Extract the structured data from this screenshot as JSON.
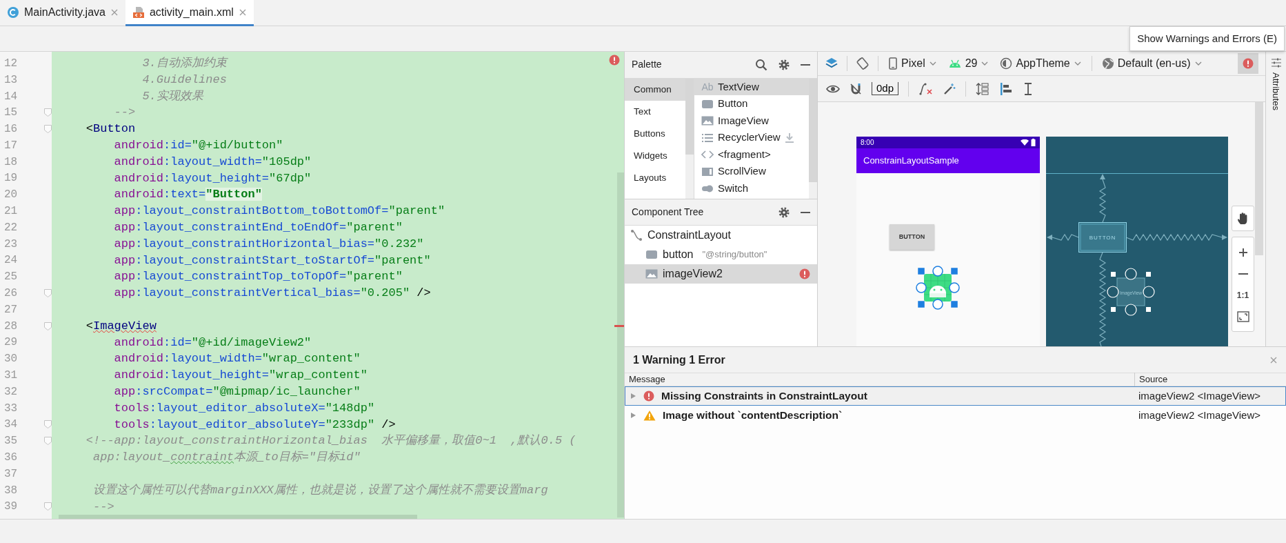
{
  "editor_tabs": [
    {
      "label": "MainActivity.java",
      "kind": "java",
      "selected": false
    },
    {
      "label": "activity_main.xml",
      "kind": "xml",
      "selected": true
    }
  ],
  "code_lines": [
    {
      "number": "12",
      "tokens": [
        {
          "kind": "comment",
          "text": "            3.自动添加约束"
        }
      ]
    },
    {
      "number": "13",
      "tokens": [
        {
          "kind": "comment",
          "text": "            4.Guidelines"
        }
      ]
    },
    {
      "number": "14",
      "tokens": [
        {
          "kind": "comment",
          "text": "            5.实现效果"
        }
      ]
    },
    {
      "number": "15",
      "fold": true,
      "tokens": [
        {
          "kind": "comment",
          "text": "        -->"
        }
      ]
    },
    {
      "number": "16",
      "fold": true,
      "tokens": [
        {
          "kind": "punct",
          "text": "    <"
        },
        {
          "kind": "tag",
          "text": "Button"
        }
      ]
    },
    {
      "number": "17",
      "tokens": [
        {
          "kind": "ns",
          "text": "        android"
        },
        {
          "kind": "attr",
          "text": ":id="
        },
        {
          "kind": "str",
          "text": "\"@+id/button\""
        }
      ]
    },
    {
      "number": "18",
      "tokens": [
        {
          "kind": "ns",
          "text": "        android"
        },
        {
          "kind": "attr",
          "text": ":layout_width="
        },
        {
          "kind": "str",
          "text": "\"105dp\""
        }
      ]
    },
    {
      "number": "19",
      "tokens": [
        {
          "kind": "ns",
          "text": "        android"
        },
        {
          "kind": "attr",
          "text": ":layout_height="
        },
        {
          "kind": "str",
          "text": "\"67dp\""
        }
      ]
    },
    {
      "number": "20",
      "tokens": [
        {
          "kind": "ns",
          "text": "        android"
        },
        {
          "kind": "attr",
          "text": ":text="
        },
        {
          "kind": "strhl",
          "text": "\"Button\""
        }
      ]
    },
    {
      "number": "21",
      "tokens": [
        {
          "kind": "ns",
          "text": "        app"
        },
        {
          "kind": "attr",
          "text": ":layout_constraintBottom_toBottomOf="
        },
        {
          "kind": "str",
          "text": "\"parent\""
        }
      ]
    },
    {
      "number": "22",
      "tokens": [
        {
          "kind": "ns",
          "text": "        app"
        },
        {
          "kind": "attr",
          "text": ":layout_constraintEnd_toEndOf="
        },
        {
          "kind": "str",
          "text": "\"parent\""
        }
      ]
    },
    {
      "number": "23",
      "tokens": [
        {
          "kind": "ns",
          "text": "        app"
        },
        {
          "kind": "attr",
          "text": ":layout_constraintHorizontal_bias="
        },
        {
          "kind": "str",
          "text": "\"0.232\""
        }
      ]
    },
    {
      "number": "24",
      "tokens": [
        {
          "kind": "ns",
          "text": "        app"
        },
        {
          "kind": "attr",
          "text": ":layout_constraintStart_toStartOf="
        },
        {
          "kind": "str",
          "text": "\"parent\""
        }
      ]
    },
    {
      "number": "25",
      "tokens": [
        {
          "kind": "ns",
          "text": "        app"
        },
        {
          "kind": "attr",
          "text": ":layout_constraintTop_toTopOf="
        },
        {
          "kind": "str",
          "text": "\"parent\""
        }
      ]
    },
    {
      "number": "26",
      "fold": true,
      "tokens": [
        {
          "kind": "ns",
          "text": "        app"
        },
        {
          "kind": "attr",
          "text": ":layout_constraintVertical_bias="
        },
        {
          "kind": "str",
          "text": "\"0.205\""
        },
        {
          "kind": "punct",
          "text": " />"
        }
      ]
    },
    {
      "number": "27"
    },
    {
      "number": "28",
      "fold": true,
      "tokens": [
        {
          "kind": "punct",
          "text": "    <"
        },
        {
          "kind": "tagerr",
          "text": "ImageView"
        }
      ]
    },
    {
      "number": "29",
      "tokens": [
        {
          "kind": "ns",
          "text": "        android"
        },
        {
          "kind": "attr",
          "text": ":id="
        },
        {
          "kind": "str",
          "text": "\"@+id/imageView2\""
        }
      ]
    },
    {
      "number": "30",
      "tokens": [
        {
          "kind": "ns",
          "text": "        android"
        },
        {
          "kind": "attr",
          "text": ":layout_width="
        },
        {
          "kind": "str",
          "text": "\"wrap_content\""
        }
      ]
    },
    {
      "number": "31",
      "tokens": [
        {
          "kind": "ns",
          "text": "        android"
        },
        {
          "kind": "attr",
          "text": ":layout_height="
        },
        {
          "kind": "str",
          "text": "\"wrap_content\""
        }
      ]
    },
    {
      "number": "32",
      "tokens": [
        {
          "kind": "ns",
          "text": "        app"
        },
        {
          "kind": "attr",
          "text": ":srcCompat="
        },
        {
          "kind": "str",
          "text": "\"@mipmap/ic_launcher\""
        }
      ]
    },
    {
      "number": "33",
      "tokens": [
        {
          "kind": "ns",
          "text": "        tools"
        },
        {
          "kind": "attr",
          "text": ":layout_editor_absoluteX="
        },
        {
          "kind": "str",
          "text": "\"148dp\""
        }
      ]
    },
    {
      "number": "34",
      "fold": true,
      "tokens": [
        {
          "kind": "ns",
          "text": "        tools"
        },
        {
          "kind": "attr",
          "text": ":layout_editor_absoluteY="
        },
        {
          "kind": "str",
          "text": "\"233dp\""
        },
        {
          "kind": "punct",
          "text": " />"
        }
      ]
    },
    {
      "number": "35",
      "fold": true,
      "tokens": [
        {
          "kind": "comment",
          "text": "    <!--app:layout_constraintHorizontal_bias  水平偏移量，取值0~1  ,默认0.5 ("
        }
      ]
    },
    {
      "number": "36",
      "tokens": [
        {
          "kind": "comment",
          "text": "     app:layout_"
        },
        {
          "kind": "typo",
          "text": "contraint"
        },
        {
          "kind": "comment",
          "text": "本源_to目标=\"目标id\""
        }
      ]
    },
    {
      "number": "37"
    },
    {
      "number": "38",
      "tokens": [
        {
          "kind": "comment",
          "text": "     设置这个属性可以代替marginXXX属性，也就是说，设置了这个属性就不需要设置marg"
        }
      ]
    },
    {
      "number": "39",
      "fold": true,
      "tokens": [
        {
          "kind": "comment",
          "text": "     -->"
        }
      ]
    }
  ],
  "palette": {
    "title": "Palette",
    "categories": [
      {
        "label": "Common",
        "selected": true
      },
      {
        "label": "Text",
        "selected": false
      },
      {
        "label": "Buttons",
        "selected": false
      },
      {
        "label": "Widgets",
        "selected": false
      },
      {
        "label": "Layouts",
        "selected": false
      }
    ],
    "items": [
      {
        "label": "TextView",
        "kind": "text",
        "icon_text": "Ab",
        "selected": true,
        "downloadable": false
      },
      {
        "label": "Button",
        "kind": "button",
        "selected": false,
        "downloadable": false
      },
      {
        "label": "ImageView",
        "kind": "image",
        "selected": false,
        "downloadable": false
      },
      {
        "label": "RecyclerView",
        "kind": "list",
        "selected": false,
        "downloadable": true
      },
      {
        "label": "<fragment>",
        "kind": "code",
        "selected": false,
        "downloadable": false
      },
      {
        "label": "ScrollView",
        "kind": "scroll",
        "selected": false,
        "downloadable": false
      },
      {
        "label": "Switch",
        "kind": "switch",
        "selected": false,
        "downloadable": false
      }
    ]
  },
  "component_tree": {
    "title": "Component Tree",
    "nodes": [
      {
        "label": "ConstraintLayout",
        "kind": "layout",
        "selected": false,
        "error": false,
        "children": [
          {
            "label": "button",
            "hint": "\"@string/button\"",
            "kind": "button",
            "selected": false,
            "error": false
          },
          {
            "label": "imageView2",
            "kind": "image",
            "selected": true,
            "error": true
          }
        ]
      }
    ]
  },
  "design_toolbar": {
    "device": "Pixel",
    "api_level": "29",
    "theme": "AppTheme",
    "locale": "Default (en-us)",
    "default_margin": "0dp"
  },
  "tooltip": "Show Warnings and Errors (E)",
  "preview": {
    "status_time": "8:00",
    "app_title": "ConstrainLayoutSample",
    "button_text": "BUTTON"
  },
  "blueprint": {
    "button_text": "BUTTON",
    "image_label": "ImageView"
  },
  "zoom_controls": {
    "actual_size": "1:1"
  },
  "side_tab": "Attributes",
  "issues_panel": {
    "title": "1 Warning 1 Error",
    "columns": [
      "Message",
      "Source"
    ],
    "rows": [
      {
        "kind": "error",
        "message": "Missing Constraints in ConstraintLayout",
        "source": "imageView2 <ImageView>",
        "selected": true,
        "expanded": false
      },
      {
        "kind": "warning",
        "message": "Image without `contentDescription`",
        "source": "imageView2 <ImageView>",
        "selected": false,
        "expanded": false
      }
    ]
  }
}
